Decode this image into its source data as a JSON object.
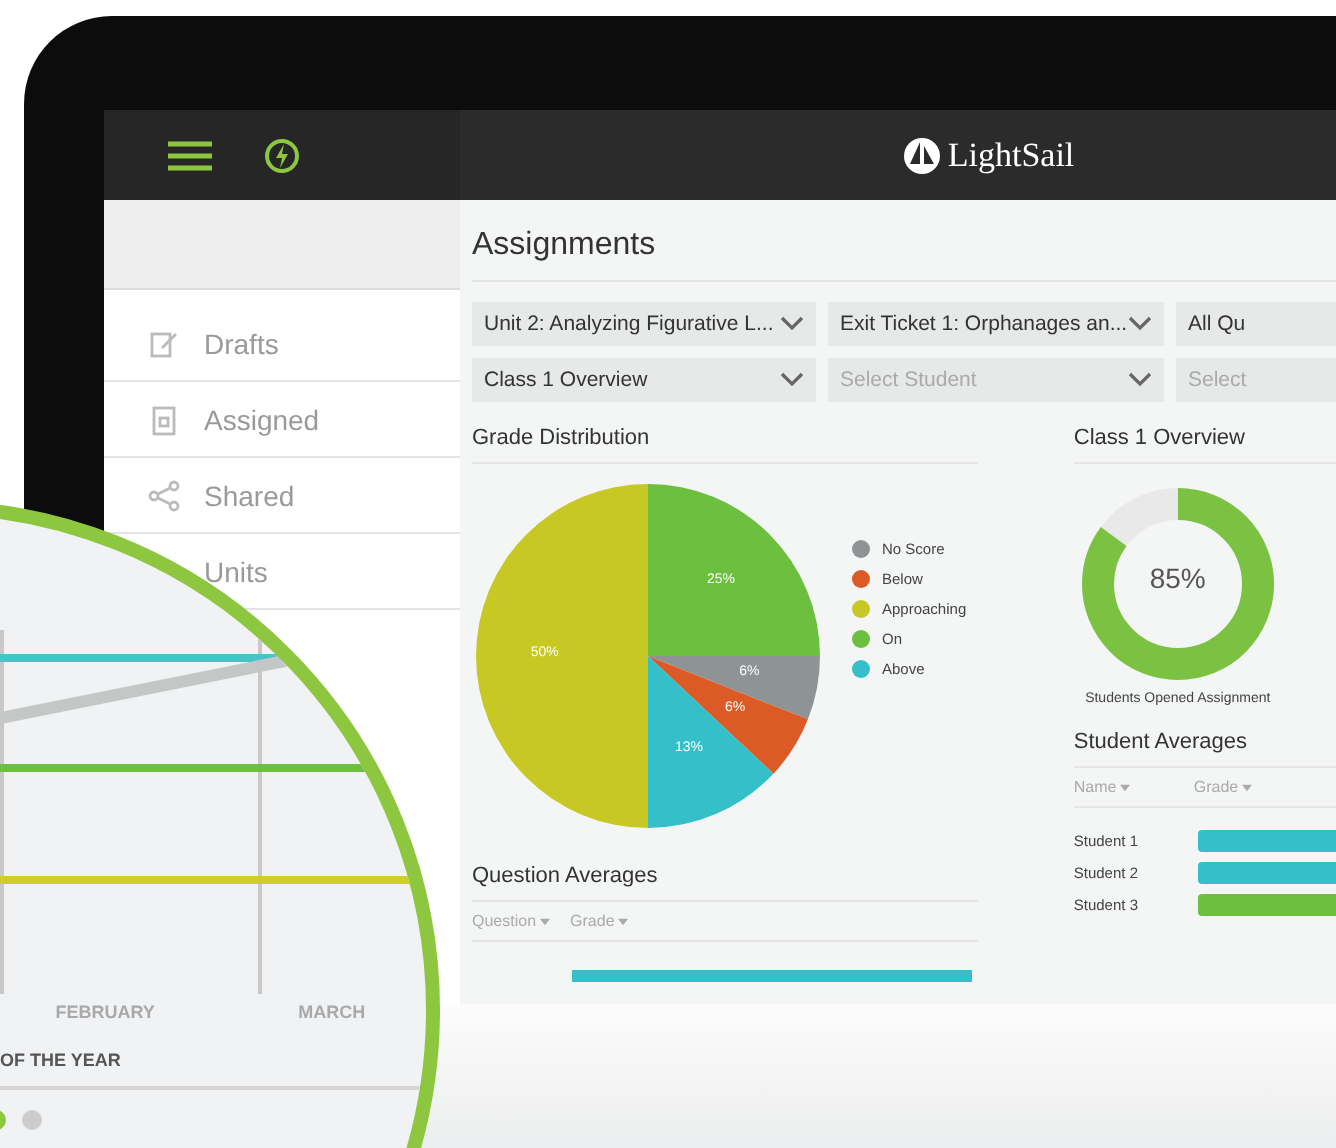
{
  "topbar": {
    "logo": "LightSail"
  },
  "sidebar": {
    "items": [
      {
        "label": "Drafts",
        "kind": "drafts"
      },
      {
        "label": "Assigned",
        "kind": "assigned"
      },
      {
        "label": "Shared",
        "kind": "shared"
      },
      {
        "label": "Units",
        "kind": "units"
      }
    ]
  },
  "page": {
    "title": "Assignments"
  },
  "filters": [
    [
      {
        "value": "Unit 2: Analyzing Figurative L...",
        "kind": "value"
      },
      {
        "value": "Exit Ticket 1: Orphanages an...",
        "kind": "value"
      },
      {
        "value": "All Qu",
        "kind": "value"
      }
    ],
    [
      {
        "value": "Class 1 Overview",
        "kind": "value"
      },
      {
        "placeholder": "Select Student",
        "kind": "placeholder"
      },
      {
        "placeholder": "Select",
        "kind": "placeholder"
      }
    ]
  ],
  "grade_distribution": {
    "title": "Grade Distribution",
    "chart_data": {
      "type": "pie",
      "values": [
        25,
        6,
        6,
        13,
        50
      ],
      "colors": [
        "#6cbf3f",
        "#8e9396",
        "#dc5a26",
        "#35bfc8",
        "#c8c824"
      ],
      "value_labels": [
        "25%",
        "6%",
        "6%",
        "13%",
        "50%"
      ]
    },
    "legend": [
      {
        "label": "No Score",
        "color": "#8e9396"
      },
      {
        "label": "Below",
        "color": "#dc5a26"
      },
      {
        "label": "Approaching",
        "color": "#c8c824"
      },
      {
        "label": "On",
        "color": "#6cbf3f"
      },
      {
        "label": "Above",
        "color": "#35bfc8"
      }
    ]
  },
  "question_averages": {
    "title": "Question Averages",
    "sorts": [
      "Question",
      "Grade"
    ]
  },
  "class_overview": {
    "title": "Class 1 Overview",
    "level": 0.85,
    "reading": "85%",
    "caption": "Students Opened Assignment"
  },
  "student_averages": {
    "title": "Student Averages",
    "sorts": [
      "Name",
      "Grade"
    ],
    "rows": [
      {
        "name": "Student 1",
        "color": "#35bfc8"
      },
      {
        "name": "Student 2",
        "color": "#35bfc8"
      },
      {
        "name": "Student 3",
        "color": "#6cbf3f"
      }
    ]
  },
  "magnifier": {
    "months": [
      "FEBRUARY",
      "MARCH"
    ],
    "caption": "OF THE YEAR",
    "dots": [
      {
        "selected": true
      },
      {
        "selected": false
      }
    ]
  }
}
